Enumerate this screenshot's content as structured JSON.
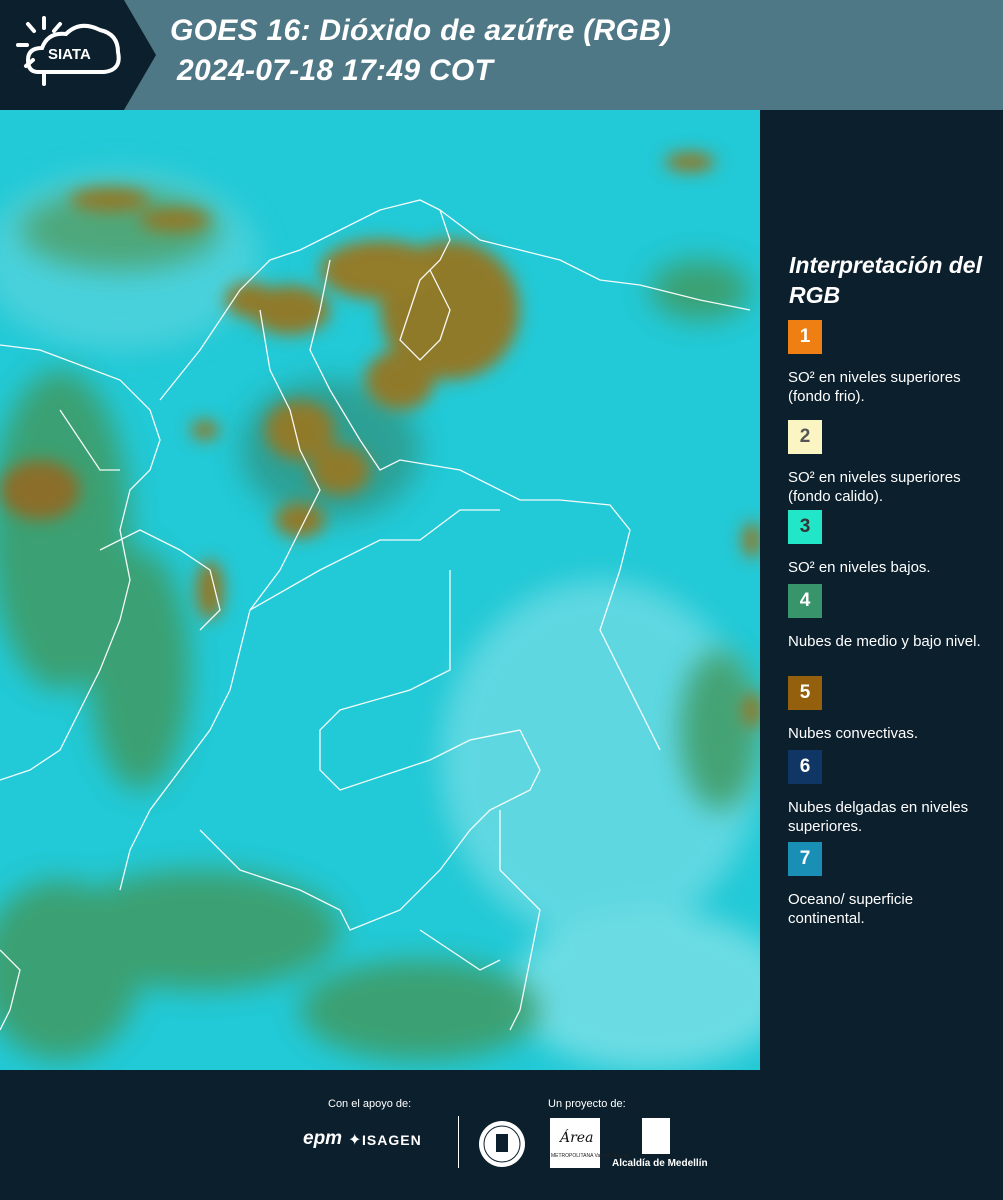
{
  "header": {
    "logo_text": "SIATA",
    "title_line1": "GOES 16: Dióxido de azúfre (RGB)",
    "title_line2": "2024-07-18 17:49 COT",
    "background_color": "#4f7886"
  },
  "legend": {
    "title": "Interpretación del RGB",
    "items": [
      {
        "number": "1",
        "color": "#f07f13",
        "label": "SO² en niveles superiores (fondo frio)."
      },
      {
        "number": "2",
        "color": "#fbf5c4",
        "label": "SO² en niveles superiores (fondo calido)."
      },
      {
        "number": "3",
        "color": "#21e6c8",
        "label": "SO² en niveles bajos."
      },
      {
        "number": "4",
        "color": "#38946a",
        "label": "Nubes de medio y bajo nivel."
      },
      {
        "number": "5",
        "color": "#94600e",
        "label": "Nubes convectivas."
      },
      {
        "number": "6",
        "color": "#0f3664",
        "label": "Nubes delgadas en niveles superiores."
      },
      {
        "number": "7",
        "color": "#1a8fb6",
        "label": "Oceano/ superficie continental."
      }
    ]
  },
  "footer": {
    "support_label": "Con el apoyo de:",
    "project_label": "Un proyecto de:",
    "sponsor1": "epm",
    "sponsor2": "ISAGEN",
    "partner_area": "Área",
    "partner_area_sub": "METROPOLITANA Valle de Aburrá",
    "partner_alcaldia": "Alcaldía de Medellín"
  },
  "map": {
    "base_color": "#22c9d6",
    "cloud_colors": [
      "#8f7a2c",
      "#3f9a62",
      "#1f8fa0"
    ],
    "border_color": "#ffffff"
  }
}
